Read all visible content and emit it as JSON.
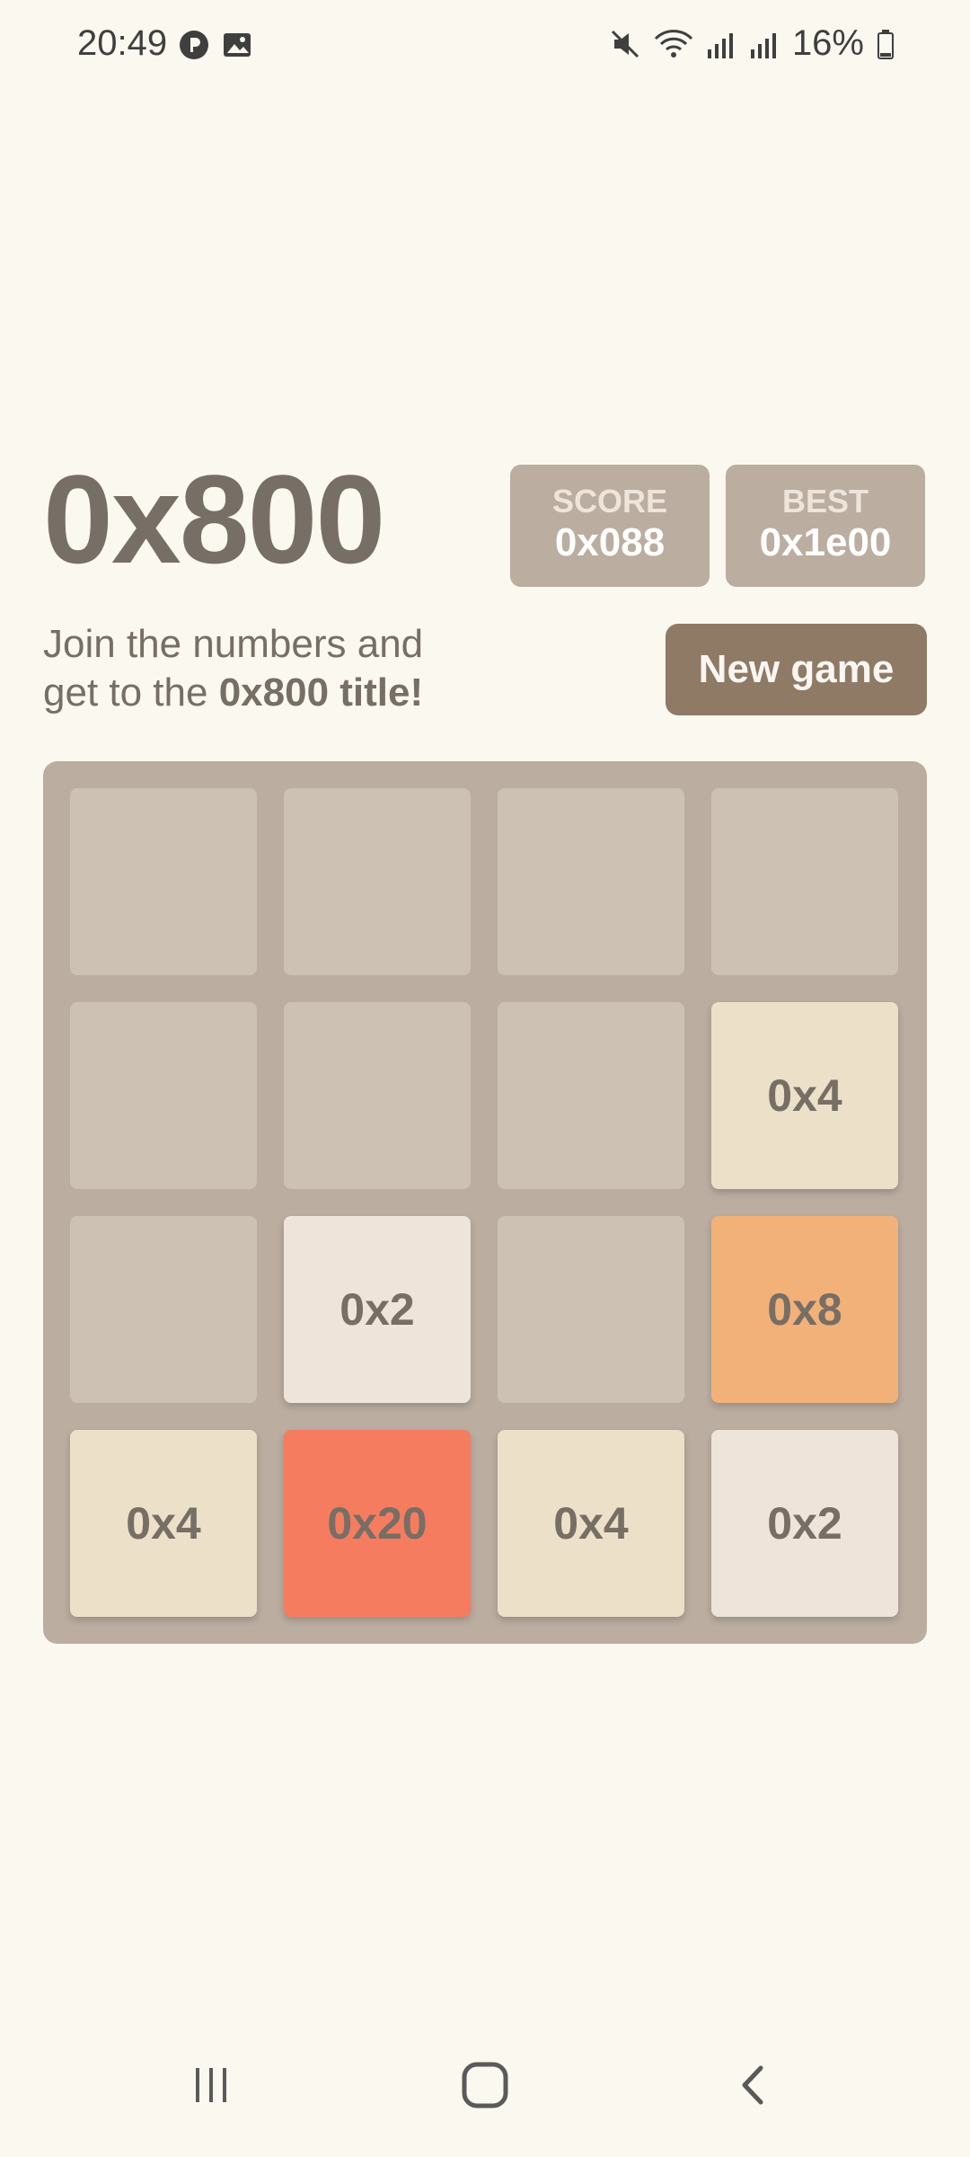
{
  "status_bar": {
    "time": "20:49",
    "battery": "16%",
    "left_icons": [
      "p-circle-icon",
      "image-icon"
    ],
    "right_icons": [
      "mute-icon",
      "wifi-icon",
      "signal-icon",
      "signal-icon-2",
      "battery-icon"
    ]
  },
  "header": {
    "title": "0x800",
    "score_label": "SCORE",
    "score_value": "0x088",
    "best_label": "BEST",
    "best_value": "0x1e00"
  },
  "intro": {
    "line1": "Join the numbers and",
    "line2_prefix": "get to the ",
    "line2_bold": "0x800 title!"
  },
  "new_game_label": "New game",
  "board": {
    "rows": [
      [
        "",
        "",
        "",
        ""
      ],
      [
        "",
        "",
        "",
        "0x4"
      ],
      [
        "",
        "0x2",
        "",
        "0x8"
      ],
      [
        "0x4",
        "0x20",
        "0x4",
        "0x2"
      ]
    ]
  },
  "nav_bar": {
    "buttons": [
      "recent-apps-icon",
      "home-icon",
      "back-icon"
    ]
  },
  "colors": {
    "background": "#faf8ef",
    "board": "#bbada0",
    "empty_cell": "#cdc1b4",
    "tile_0x2": "#eee4da",
    "tile_0x4": "#ede0c8",
    "tile_0x8": "#f2b179",
    "tile_0x20": "#f67c5f",
    "text": "#776e65",
    "button": "#8f7a66"
  }
}
